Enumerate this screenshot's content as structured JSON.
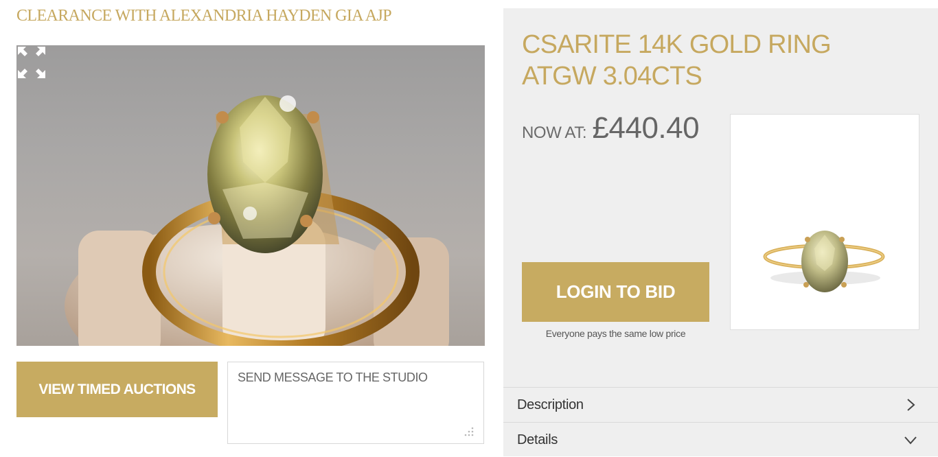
{
  "show": {
    "title": "CLEARANCE WITH ALEXANDRIA HAYDEN GIA AJP",
    "fullscreen_icon": "expand-arrows-icon"
  },
  "actions": {
    "timed_auctions_label": "VIEW TIMED AUCTIONS",
    "message_placeholder": "SEND MESSAGE TO THE STUDIO",
    "resize_icon": "resize-grip-icon"
  },
  "product": {
    "title": "CSARITE 14K GOLD RING ATGW 3.04CTS",
    "price_label": "NOW AT:",
    "price_value": "£440.40",
    "login_label": "LOGIN TO BID",
    "tagline": "Everyone pays the same low price"
  },
  "accordion": [
    {
      "label": "Description",
      "icon": "chevron-right-icon"
    },
    {
      "label": "Details",
      "icon": "chevron-down-icon"
    }
  ],
  "colors": {
    "gold": "#c7ab61",
    "gold_text": "#c6a85f",
    "panel_bg": "#efefef"
  }
}
